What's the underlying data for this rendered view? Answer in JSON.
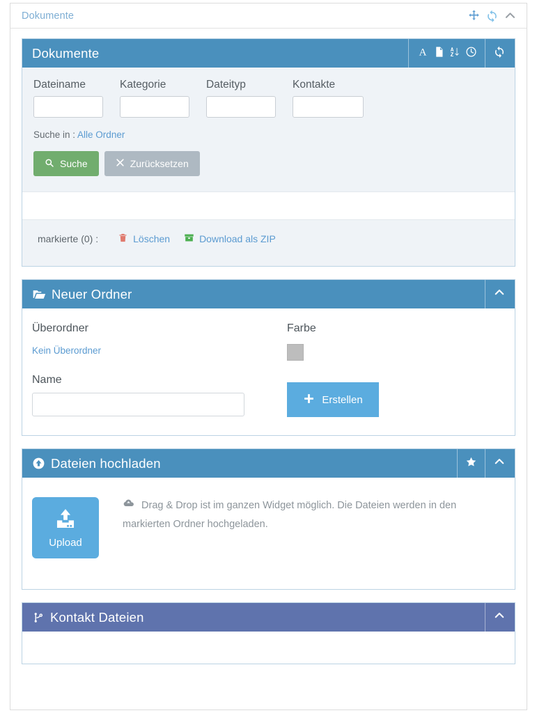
{
  "window": {
    "title": "Dokumente",
    "tools": [
      {
        "name": "move-icon",
        "label": "Verschieben"
      },
      {
        "name": "refresh-icon",
        "label": "Aktualisieren"
      },
      {
        "name": "collapse-icon",
        "label": "Einklappen"
      }
    ]
  },
  "documents_panel": {
    "title": "Dokumente",
    "header_icons": [
      {
        "name": "font-icon",
        "label": "A"
      },
      {
        "name": "file-icon",
        "label": "Datei"
      },
      {
        "name": "sort-alpha-icon",
        "label": "Sortieren"
      },
      {
        "name": "clock-icon",
        "label": "Zeit"
      },
      {
        "name": "refresh-icon",
        "label": "Aktualisieren"
      }
    ],
    "fields": [
      {
        "label": "Dateiname",
        "value": "",
        "placeholder": ""
      },
      {
        "label": "Kategorie",
        "value": "",
        "placeholder": ""
      },
      {
        "label": "Dateityp",
        "value": "",
        "placeholder": ""
      },
      {
        "label": "Kontakte",
        "value": "",
        "placeholder": ""
      }
    ],
    "search_in_label": "Suche in : ",
    "search_in_value": "Alle Ordner",
    "search_button": "Suche",
    "reset_button": "Zurücksetzen",
    "marked_label": "markierte (0) :",
    "delete_action": "Löschen",
    "zip_action": "Download als ZIP"
  },
  "folder_panel": {
    "title": "Neuer Ordner",
    "parent_label": "Überordner",
    "parent_value": "Kein Überordner",
    "name_label": "Name",
    "name_value": "",
    "color_label": "Farbe",
    "color_value": "#bdbdbd",
    "create_button": "Erstellen"
  },
  "upload_panel": {
    "title": "Dateien hochladen",
    "upload_button": "Upload",
    "hint": "Drag & Drop ist im ganzen Widget möglich. Die Dateien werden in den markierten Ordner hochgeladen."
  },
  "kontakt_panel": {
    "title": "Kontakt Dateien"
  },
  "colors": {
    "panel_blue": "#4a90bd",
    "panel_purple": "#5f73ad",
    "accent_blue": "#5bacdf",
    "link_blue": "#5b9bd1",
    "green": "#71ad6e",
    "gray": "#aeb9c2",
    "danger_red": "#e07a6e",
    "zip_green": "#4caf50"
  }
}
